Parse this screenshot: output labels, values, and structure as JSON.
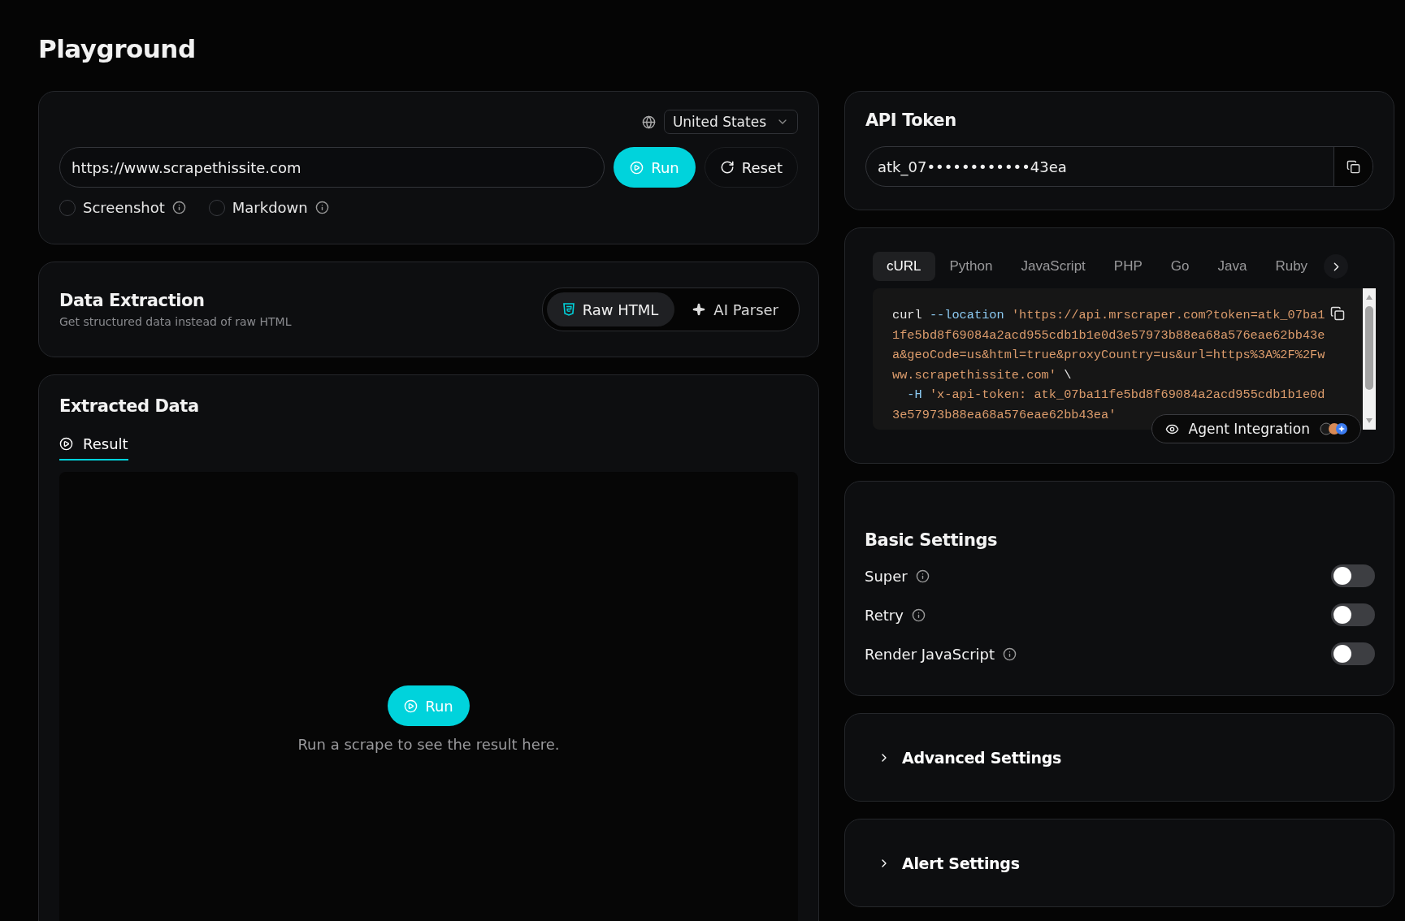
{
  "page_title": "Playground",
  "scrape_card": {
    "country": {
      "value": "United States"
    },
    "url": {
      "value": "https://www.scrapethissite.com"
    },
    "run_button": "Run",
    "reset_button": "Reset",
    "options": [
      {
        "label": "Screenshot",
        "checked": false
      },
      {
        "label": "Markdown",
        "checked": false
      }
    ]
  },
  "data_extraction": {
    "title": "Data Extraction",
    "subtitle": "Get structured data instead of raw HTML",
    "modes": [
      {
        "label": "Raw HTML",
        "kind": "html",
        "selected": true
      },
      {
        "label": "AI Parser",
        "kind": "ai",
        "selected": false
      }
    ]
  },
  "extracted_data": {
    "title": "Extracted Data",
    "tabs": [
      {
        "label": "Result",
        "selected": true
      }
    ],
    "run_button": "Run",
    "empty_message": "Run a scrape to see the result here."
  },
  "api_token": {
    "title": "API Token",
    "value": "atk_07••••••••••••43ea"
  },
  "code_sample": {
    "languages": [
      {
        "label": "cURL",
        "selected": true
      },
      {
        "label": "Python",
        "selected": false
      },
      {
        "label": "JavaScript",
        "selected": false
      },
      {
        "label": "PHP",
        "selected": false
      },
      {
        "label": "Go",
        "selected": false
      },
      {
        "label": "Java",
        "selected": false
      },
      {
        "label": "Ruby",
        "selected": false
      }
    ],
    "lines": [
      [
        {
          "kind": "cmd",
          "text": "curl "
        },
        {
          "kind": "flag",
          "text": "--location "
        },
        {
          "kind": "string",
          "text": "'https://api.mrscraper.com?token=atk_07ba1"
        }
      ],
      [
        {
          "kind": "string",
          "text": "1fe5bd8f69084a2acd955cdb1b1e0d3e57973b88ea68a576eae62bb43e"
        }
      ],
      [
        {
          "kind": "string",
          "text": "a&geoCode=us&html=true&proxyCountry=us&url=https%3A%2F%2Fw"
        }
      ],
      [
        {
          "kind": "string",
          "text": "ww.scrapethissite.com'"
        },
        {
          "kind": "cmd",
          "text": " \\"
        }
      ],
      [
        {
          "kind": "flag",
          "text": "  -H "
        },
        {
          "kind": "string",
          "text": "'x-api-token: atk_07ba11fe5bd8f69084a2acd955cdb1b1e0d"
        }
      ],
      [
        {
          "kind": "string",
          "text": "3e57973b88ea68a576eae62bb43ea'"
        }
      ]
    ],
    "agent_button": "Agent Integration"
  },
  "basic_settings": {
    "title": "Basic Settings",
    "settings": [
      {
        "label": "Super",
        "on": false
      },
      {
        "label": "Retry",
        "on": false
      },
      {
        "label": "Render JavaScript",
        "on": false
      }
    ]
  },
  "sections": [
    {
      "title": "Advanced Settings",
      "expanded": false
    },
    {
      "title": "Alert Settings",
      "expanded": false
    }
  ]
}
